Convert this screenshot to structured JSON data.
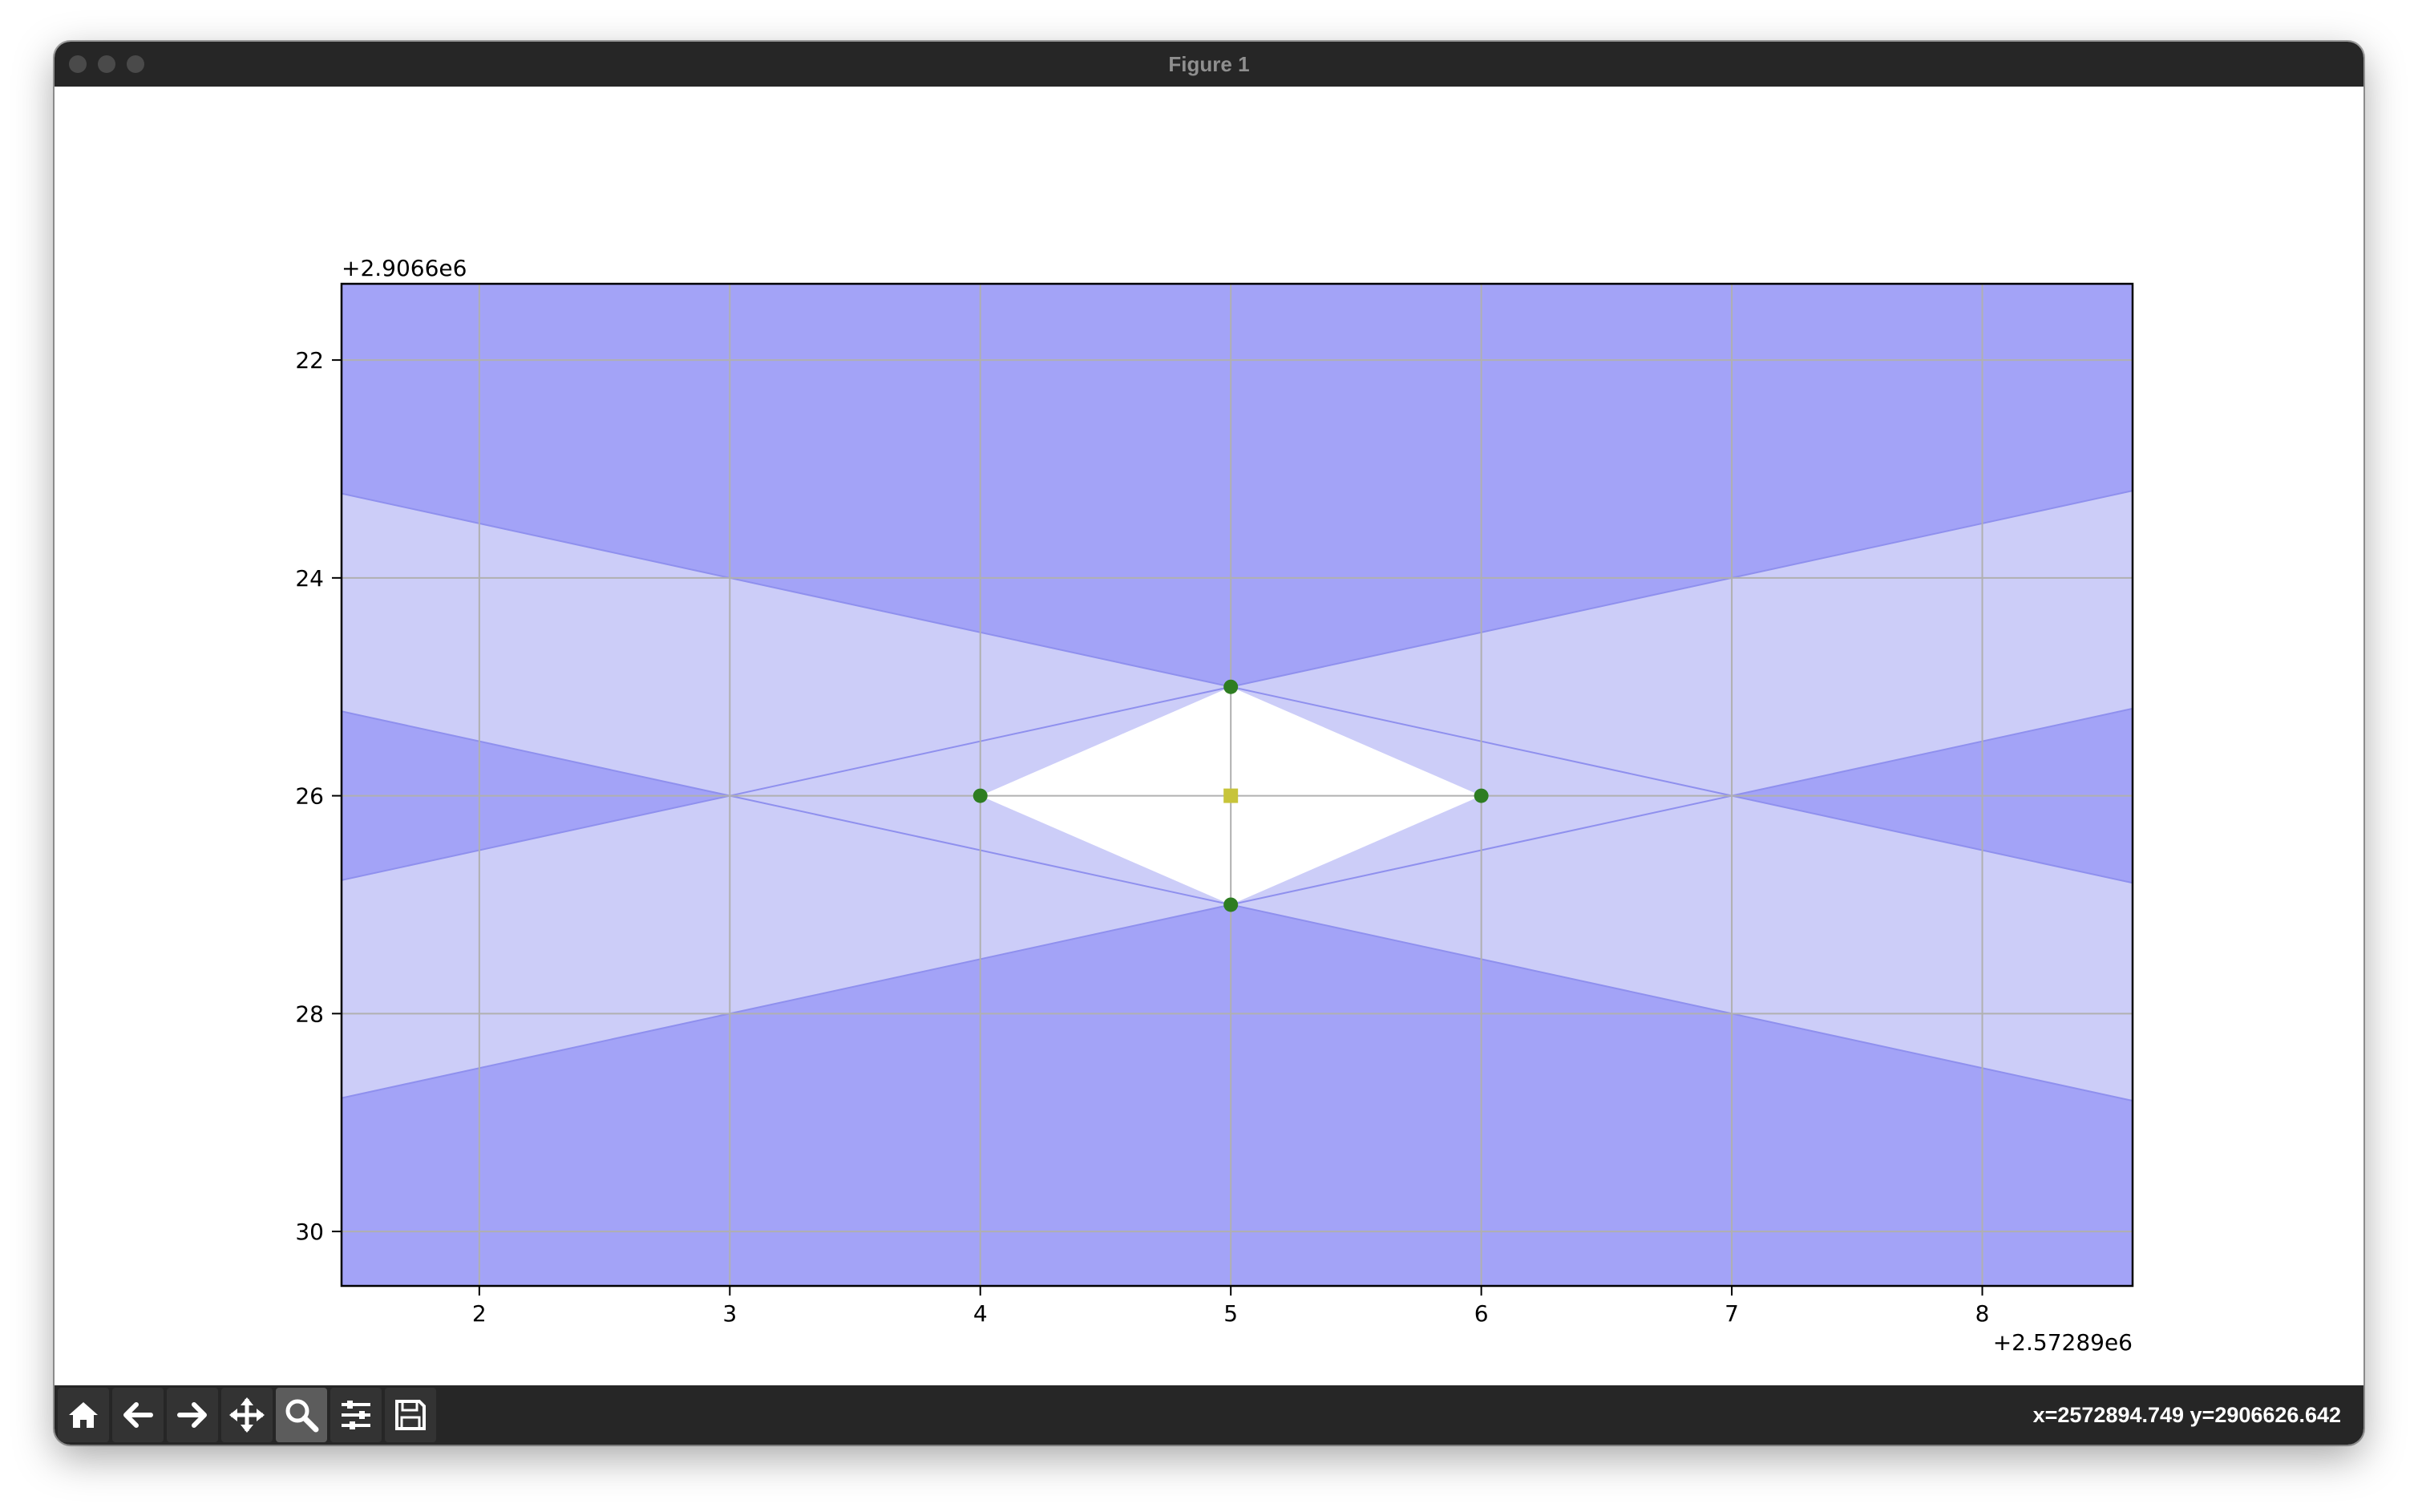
{
  "window": {
    "title": "Figure 1"
  },
  "toolbar": {
    "tools": [
      {
        "icon": "home-icon",
        "label": "Home"
      },
      {
        "icon": "back-arrow-icon",
        "label": "Back"
      },
      {
        "icon": "forward-arrow-icon",
        "label": "Forward"
      },
      {
        "icon": "pan-move-icon",
        "label": "Pan"
      },
      {
        "icon": "zoom-magnifier-icon",
        "label": "Zoom",
        "active": true
      },
      {
        "icon": "subplots-sliders-icon",
        "label": "Configure subplots"
      },
      {
        "icon": "save-disk-icon",
        "label": "Save"
      }
    ],
    "coords_text": "x=2572894.749 y=2906626.642"
  },
  "colors": {
    "dark_band": "#a3a3f7",
    "light_band": "#cccdf8",
    "edge": "#8f90ee",
    "center": "#ffffff",
    "green_point": "#2e7d22",
    "yellow_square": "#c7c43a",
    "grid": "#b0b0b0"
  },
  "chart_data": {
    "type": "scatter",
    "title": "",
    "xlabel": "",
    "ylabel": "",
    "x_offset_label": "+2.57289e6",
    "y_offset_label": "+2.9066e6",
    "xlim": [
      1.45,
      8.6
    ],
    "ylim": [
      30.5,
      21.3
    ],
    "y_inverted": true,
    "grid": true,
    "x_ticks": [
      2,
      3,
      4,
      5,
      6,
      7,
      8
    ],
    "y_ticks": [
      22,
      24,
      26,
      28,
      30
    ],
    "points": [
      {
        "x": 5,
        "y": 25,
        "marker": "circle",
        "color": "green"
      },
      {
        "x": 4,
        "y": 26,
        "marker": "circle",
        "color": "green"
      },
      {
        "x": 6,
        "y": 26,
        "marker": "circle",
        "color": "green"
      },
      {
        "x": 5,
        "y": 27,
        "marker": "circle",
        "color": "green"
      }
    ],
    "center_point": {
      "x": 5,
      "y": 26,
      "marker": "square",
      "color": "yellow"
    },
    "band_lines": [
      {
        "name": "line-a",
        "slope": 0.5,
        "intercept": 22.5
      },
      {
        "name": "line-b",
        "slope": 0.5,
        "intercept": 24.5
      },
      {
        "name": "line-c",
        "slope": -0.5,
        "intercept": 27.5
      },
      {
        "name": "line-d",
        "slope": -0.5,
        "intercept": 29.5
      }
    ]
  }
}
